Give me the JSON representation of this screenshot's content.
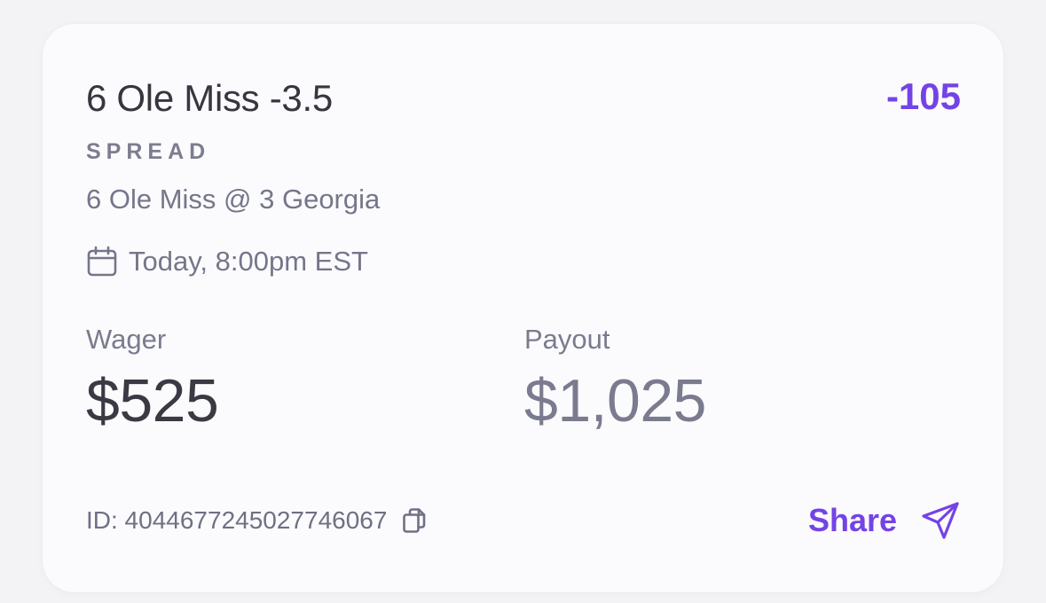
{
  "bet": {
    "title": "6 Ole Miss -3.5",
    "odds": "-105",
    "market": "SPREAD",
    "matchup": "6 Ole Miss @ 3 Georgia",
    "datetime": "Today, 8:00pm EST"
  },
  "stats": {
    "wager_label": "Wager",
    "wager_value": "$525",
    "payout_label": "Payout",
    "payout_value": "$1,025"
  },
  "footer": {
    "id_text": "ID: 4044677245027746067",
    "share_label": "Share"
  },
  "icons": {
    "calendar": "calendar-icon",
    "copy": "copy-icon",
    "send": "send-icon"
  },
  "colors": {
    "accent": "#7443e6",
    "title_text": "#35363f",
    "muted_text": "#75768a",
    "card_bg": "#fbfbfd",
    "page_bg": "#f3f3f6"
  }
}
